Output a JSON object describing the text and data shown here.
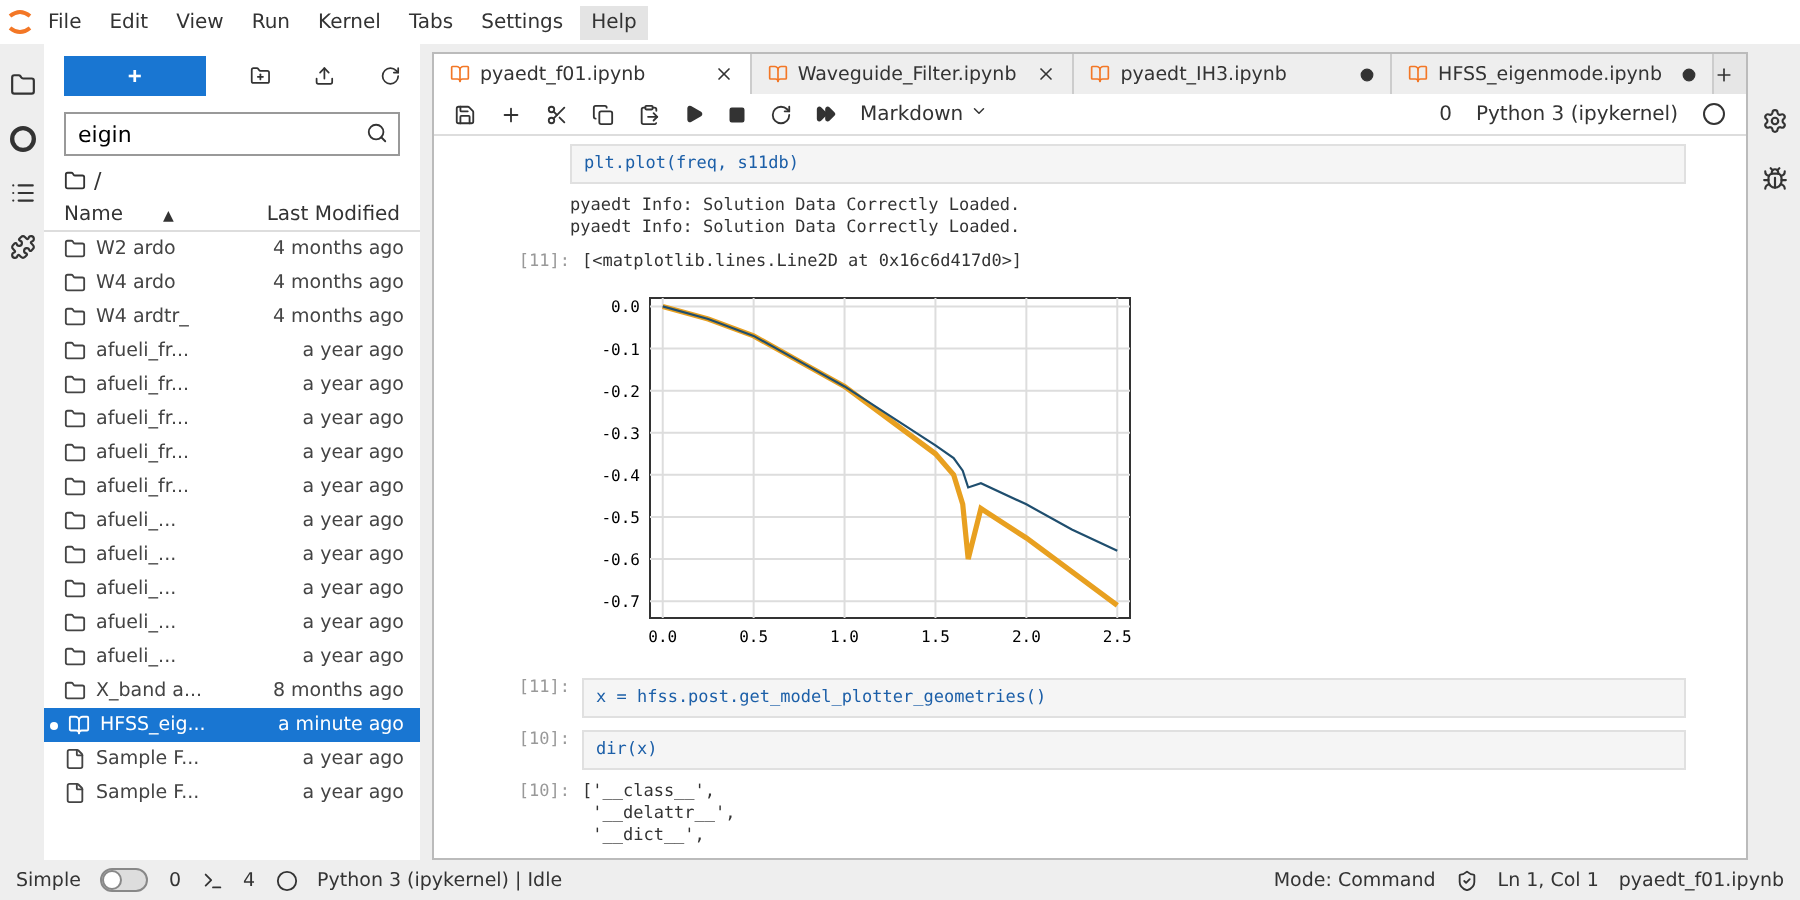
{
  "menu": [
    {
      "label": "File",
      "selected": false
    },
    {
      "label": "Edit",
      "selected": false
    },
    {
      "label": "View",
      "selected": false
    },
    {
      "label": "Run",
      "selected": false
    },
    {
      "label": "Kernel",
      "selected": false
    },
    {
      "label": "Tabs",
      "selected": false
    },
    {
      "label": "Settings",
      "selected": false
    },
    {
      "label": "Help",
      "selected": true
    }
  ],
  "filebrowser": {
    "new_button": "+",
    "search": {
      "value": "eigin"
    },
    "path": "/",
    "columns": [
      {
        "label": "Name",
        "sorted": true,
        "sort_arrow": "▲"
      },
      {
        "label": "Last Modified",
        "sorted": false
      }
    ],
    "items": [
      {
        "kind": "folder",
        "name": "W2 ardo",
        "modified": "4 months ago",
        "selected": false,
        "running": false
      },
      {
        "kind": "folder",
        "name": "W4 ardo",
        "modified": "4 months ago",
        "selected": false,
        "running": false
      },
      {
        "kind": "folder",
        "name": "W4 ardtr_",
        "modified": "4 months ago",
        "selected": false,
        "running": false
      },
      {
        "kind": "folder",
        "name": "afueli_fr...",
        "modified": "a year ago",
        "selected": false,
        "running": false
      },
      {
        "kind": "folder",
        "name": "afueli_fr...",
        "modified": "a year ago",
        "selected": false,
        "running": false
      },
      {
        "kind": "folder",
        "name": "afueli_fr...",
        "modified": "a year ago",
        "selected": false,
        "running": false
      },
      {
        "kind": "folder",
        "name": "afueli_fr...",
        "modified": "a year ago",
        "selected": false,
        "running": false
      },
      {
        "kind": "folder",
        "name": "afueli_fr...",
        "modified": "a year ago",
        "selected": false,
        "running": false
      },
      {
        "kind": "folder",
        "name": "afueli_...",
        "modified": "a year ago",
        "selected": false,
        "running": false
      },
      {
        "kind": "folder",
        "name": "afueli_...",
        "modified": "a year ago",
        "selected": false,
        "running": false
      },
      {
        "kind": "folder",
        "name": "afueli_...",
        "modified": "a year ago",
        "selected": false,
        "running": false
      },
      {
        "kind": "folder",
        "name": "afueli_...",
        "modified": "a year ago",
        "selected": false,
        "running": false
      },
      {
        "kind": "folder",
        "name": "afueli_...",
        "modified": "a year ago",
        "selected": false,
        "running": false
      },
      {
        "kind": "folder",
        "name": "X_band a...",
        "modified": "8 months ago",
        "selected": false,
        "running": false
      },
      {
        "kind": "notebook",
        "name": "HFSS_eig...",
        "modified": "a minute ago",
        "selected": true,
        "running": true
      },
      {
        "kind": "file",
        "name": "Sample F...",
        "modified": "a year ago",
        "selected": false,
        "running": false
      },
      {
        "kind": "file",
        "name": "Sample F...",
        "modified": "a year ago",
        "selected": false,
        "running": false
      }
    ]
  },
  "tabs": [
    {
      "label": "pyaedt_f01.ipynb",
      "selected": true,
      "modified": false
    },
    {
      "label": "Waveguide_Filter.ipynb",
      "selected": false,
      "modified": false
    },
    {
      "label": "pyaedt_IH3.ipynb",
      "selected": false,
      "modified": true
    },
    {
      "label": "HFSS_eigenmode.ipynb",
      "selected": false,
      "modified": true
    }
  ],
  "toolbar": {
    "cell_type": "Markdown",
    "kernel_count": "0",
    "kernel": "Python 3 (ipykernel)",
    "kernel_busy": false
  },
  "cells": [
    {
      "kind": "input",
      "code": "plt.plot(freq, s11db)"
    },
    {
      "kind": "output",
      "lines": [
        "pyaedt Info: Solution Data Correctly Loaded.",
        "pyaedt Info: Solution Data Correctly Loaded."
      ]
    },
    {
      "kind": "output",
      "prompt": "[11]:",
      "lines": [
        "[<matplotlib.lines.Line2D at 0x16c6d417d0>]"
      ]
    },
    {
      "kind": "chart",
      "chart_data": {
        "type": "line",
        "grid": true,
        "x": [
          0,
          0.25,
          0.5,
          0.75,
          1.0,
          1.25,
          1.5,
          1.6,
          1.65,
          1.68,
          1.75,
          2.0,
          2.25,
          2.5
        ],
        "series": [
          {
            "color": "#1f4e6e",
            "values": [
              0,
              -0.03,
              -0.07,
              -0.13,
              -0.19,
              -0.26,
              -0.33,
              -0.36,
              -0.39,
              -0.43,
              -0.42,
              -0.47,
              -0.53,
              -0.58
            ]
          },
          {
            "color": "#e8a020",
            "values": [
              0,
              -0.03,
              -0.07,
              -0.13,
              -0.19,
              -0.27,
              -0.35,
              -0.4,
              -0.47,
              -0.6,
              -0.48,
              -0.55,
              -0.63,
              -0.71
            ]
          }
        ],
        "xlim": [
          -0.07,
          2.57
        ],
        "ylim": [
          -0.74,
          0.02
        ],
        "xticks": [
          {
            "value": 0,
            "label": "0.0"
          },
          {
            "value": 0.5,
            "label": "0.5"
          },
          {
            "value": 1,
            "label": "1.0"
          },
          {
            "value": 1.5,
            "label": "1.5"
          },
          {
            "value": 2,
            "label": "2.0"
          },
          {
            "value": 2.5,
            "label": "2.5"
          }
        ],
        "yticks": [
          {
            "value": 0,
            "label": "0.0"
          },
          {
            "value": -0.1,
            "label": "-0.1"
          },
          {
            "value": -0.2,
            "label": "-0.2"
          },
          {
            "value": -0.3,
            "label": "-0.3"
          },
          {
            "value": -0.4,
            "label": "-0.4"
          },
          {
            "value": -0.5,
            "label": "-0.5"
          },
          {
            "value": -0.6,
            "label": "-0.6"
          },
          {
            "value": -0.7,
            "label": "-0.7"
          }
        ]
      }
    },
    {
      "kind": "input",
      "prompt": "[11]:",
      "code": "x = hfss.post.get_model_plotter_geometries()"
    },
    {
      "kind": "input",
      "prompt": "[10]:",
      "code": "dir(x)"
    },
    {
      "kind": "output",
      "prompt": "[10]:",
      "lines": [
        "['__class__',",
        " '__delattr__',",
        " '__dict__',"
      ]
    }
  ],
  "status": {
    "simple_label": "Simple",
    "simple_on": false,
    "terminals": "0",
    "kernels": "4",
    "kernel_status": "Python 3 (ipykernel) | Idle",
    "mode": "Mode: Command",
    "position": "Ln 1, Col 1",
    "file": "pyaedt_f01.ipynb"
  }
}
